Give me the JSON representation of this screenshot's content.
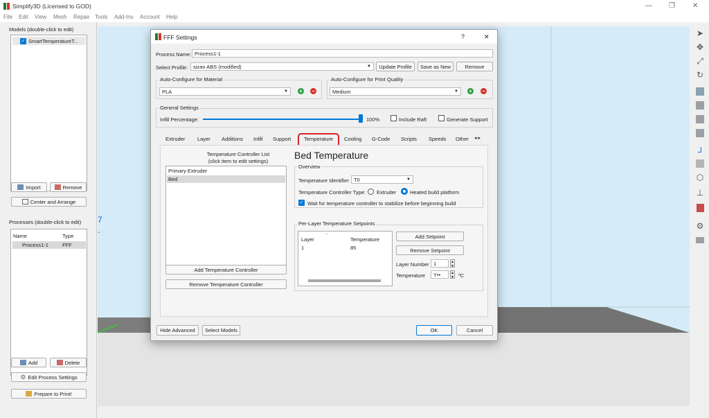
{
  "app": {
    "title": "Simplify3D (Licensed to GOD)"
  },
  "menu": [
    "File",
    "Edit",
    "View",
    "Mesh",
    "Repair",
    "Tools",
    "Add-Ins",
    "Account",
    "Help"
  ],
  "models_panel": {
    "title": "Models (double-click to edit)",
    "items": [
      "SmartTemperatureT..."
    ],
    "import_label": "Import",
    "remove_label": "Remove",
    "center_label": "Center and Arrange"
  },
  "processes_panel": {
    "title": "Processes (double-click to edit)",
    "col_name": "Name",
    "col_type": "Type",
    "rows": [
      {
        "name": "Process1-1",
        "type": "FFF"
      }
    ],
    "add_label": "Add",
    "delete_label": "Delete",
    "edit_label": "Edit Process Settings",
    "prepare_label": "Prepare to Print!"
  },
  "viewport_marks": {
    "num": "7",
    "dash": "-"
  },
  "dialog": {
    "title": "FFF Settings",
    "help": "?",
    "close": "✕",
    "process_name_label": "Process Name:",
    "process_name_value": "Process1-1",
    "select_profile_label": "Select Profile:",
    "select_profile_value": "sizan ABS  (modified)",
    "update_profile": "Update Profile",
    "save_as_new": "Save as New",
    "remove": "Remove",
    "material_title": "Auto-Configure for Material",
    "material_value": "PLA",
    "quality_title": "Auto-Configure for Print Quality",
    "quality_value": "Medium",
    "general_title": "General Settings",
    "infill_label": "Infill Percentage:",
    "infill_value": "100%",
    "infill_fraction": 1.0,
    "include_raft": "Include Raft",
    "generate_support": "Generate Support",
    "tabs": [
      "Extruder",
      "Layer",
      "Additions",
      "Infill",
      "Support",
      "Temperature",
      "Cooling",
      "G-Code",
      "Scripts",
      "Speeds",
      "Other"
    ],
    "active_tab": "Temperature",
    "tab_scroll": "◂ ▸",
    "temp": {
      "list_title_1": "Temperature Controller List",
      "list_title_2": "(click item to edit settings)",
      "controllers": [
        "Primary Extruder",
        "Bed"
      ],
      "selected_controller": "Bed",
      "add_controller": "Add Temperature Controller",
      "remove_controller": "Remove Temperature Controller",
      "heading": "Bed Temperature",
      "overview_title": "Overview",
      "identifier_label": "Temperature Identifier",
      "identifier_value": "T0",
      "controller_type_label": "Temperature Controller Type:",
      "type_extruder": "Extruder",
      "type_heated": "Heated build platform",
      "wait_label": "Wait for temperature controller to stabilize before beginning build",
      "setpoints_title": "Per-Layer Temperature Setpoints",
      "col_layer": "Layer",
      "col_temperature": "Temperature",
      "setpoints": [
        {
          "layer": "1",
          "temperature": "85"
        }
      ],
      "add_setpoint": "Add Setpoint",
      "remove_setpoint": "Remove Setpoint",
      "layer_number_label": "Layer Number",
      "layer_number_value": "1",
      "temperature_label": "Temperature",
      "temperature_value": "Y••",
      "temperature_unit": "ºC"
    },
    "hide_advanced": "Hide Advanced",
    "select_models": "Select Models",
    "ok": "OK",
    "cancel": "Cancel"
  },
  "colors": {
    "accent": "#0078d7",
    "highlight": "#d8232a",
    "viewport": "#d5ecf8",
    "add_green": "#2e9e3e",
    "remove_red": "#d9322b"
  }
}
